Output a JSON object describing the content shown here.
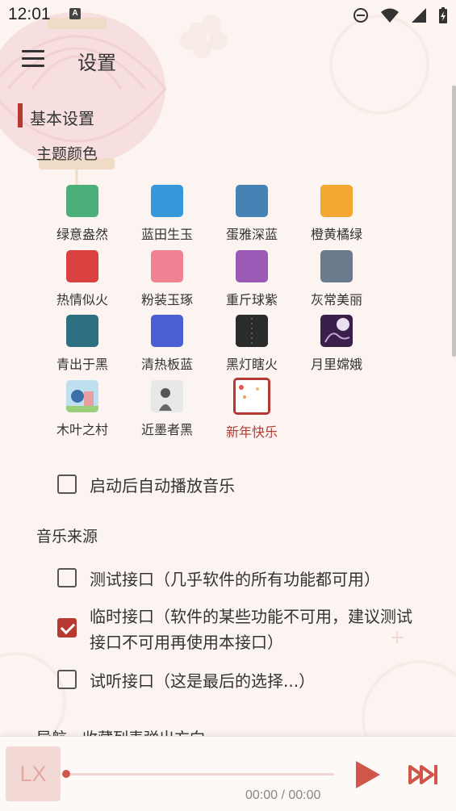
{
  "status": {
    "time": "12:01",
    "a_badge": "A"
  },
  "header": {
    "title": "设置"
  },
  "sections": {
    "basic": "基本设置",
    "theme_color": "主题颜色",
    "music_source": "音乐来源",
    "cutoff_text": "导航、收藏列表弹出方向"
  },
  "themes": [
    {
      "label": "绿意盎然",
      "color": "#4caf7a"
    },
    {
      "label": "蓝田生玉",
      "color": "#3498db"
    },
    {
      "label": "蛋雅深蓝",
      "color": "#4682b4"
    },
    {
      "label": "橙黄橘绿",
      "color": "#f5a733"
    },
    {
      "label": "热情似火",
      "color": "#d94040"
    },
    {
      "label": "粉装玉琢",
      "color": "#f08393"
    },
    {
      "label": "重斤球紫",
      "color": "#9b59b6"
    },
    {
      "label": "灰常美丽",
      "color": "#6b7a8c"
    },
    {
      "label": "青出于黑",
      "color": "#2d6e80"
    },
    {
      "label": "清热板蓝",
      "color": "#4a5fd0"
    },
    {
      "label": "黑灯瞎火",
      "color": "#2b2b2b"
    },
    {
      "label": "月里嫦娥",
      "color": "#3a1f4a"
    },
    {
      "label": "木叶之村",
      "color": "#cfe6f2"
    },
    {
      "label": "近墨者黑",
      "color": "#d8d8d8"
    },
    {
      "label": "新年快乐",
      "color": "#ffffff"
    }
  ],
  "accent": "#b63a31",
  "options": {
    "autoplay": {
      "label": "启动后自动播放音乐",
      "checked": false
    },
    "source_test": {
      "label": "测试接口（几乎软件的所有功能都可用）",
      "checked": false
    },
    "source_temp": {
      "label": "临时接口（软件的某些功能不可用，建议测试接口不可用再使用本接口）",
      "checked": true
    },
    "source_trial": {
      "label": "试听接口（这是最后的选择...）",
      "checked": false
    }
  },
  "player": {
    "album_text": "LX",
    "time": "00:00 / 00:00",
    "progress": 0
  }
}
